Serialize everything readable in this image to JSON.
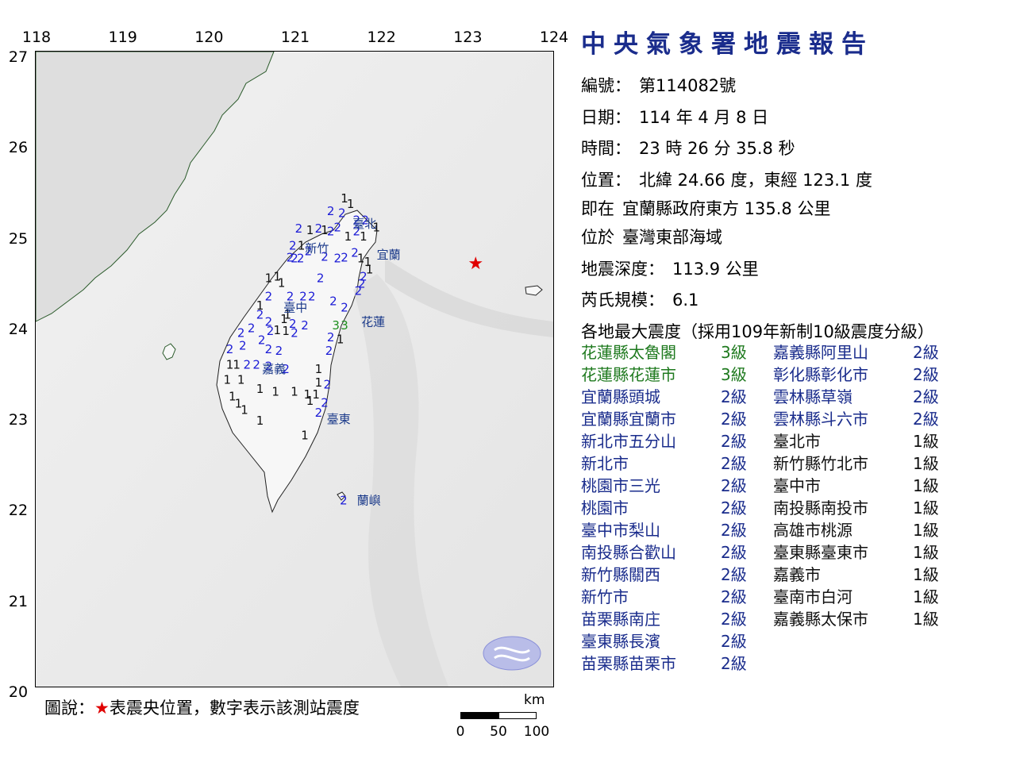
{
  "report": {
    "title": "中央氣象署地震報告",
    "number_label": "編號：",
    "number_value": "第114082號",
    "date_label": "日期：",
    "date_value": "114 年 4 月 8 日",
    "time_label": "時間：",
    "time_value": "23 時 26 分 35.8 秒",
    "position_label": "位置：",
    "position_value": "北緯 24.66 度，東經 123.1 度",
    "relative_label": "即在",
    "relative_value": "宜蘭縣政府東方 135.8 公里",
    "region_label": "位於",
    "region_value": "臺灣東部海域",
    "depth_label": "地震深度：",
    "depth_value": "113.9 公里",
    "magnitude_label": "芮氏規模：",
    "magnitude_value": "6.1",
    "intensity_heading": "各地最大震度（採用109年新制10級震度分級）"
  },
  "intensity_left": [
    {
      "location": "花蓮縣太魯閣",
      "level": "3級",
      "grade": 3
    },
    {
      "location": "花蓮縣花蓮市",
      "level": "3級",
      "grade": 3
    },
    {
      "location": "宜蘭縣頭城",
      "level": "2級",
      "grade": 2
    },
    {
      "location": "宜蘭縣宜蘭市",
      "level": "2級",
      "grade": 2
    },
    {
      "location": "新北市五分山",
      "level": "2級",
      "grade": 2
    },
    {
      "location": "新北市",
      "level": "2級",
      "grade": 2
    },
    {
      "location": "桃園市三光",
      "level": "2級",
      "grade": 2
    },
    {
      "location": "桃園市",
      "level": "2級",
      "grade": 2
    },
    {
      "location": "臺中市梨山",
      "level": "2級",
      "grade": 2
    },
    {
      "location": "南投縣合歡山",
      "level": "2級",
      "grade": 2
    },
    {
      "location": "新竹縣關西",
      "level": "2級",
      "grade": 2
    },
    {
      "location": "新竹市",
      "level": "2級",
      "grade": 2
    },
    {
      "location": "苗栗縣南庄",
      "level": "2級",
      "grade": 2
    },
    {
      "location": "臺東縣長濱",
      "level": "2級",
      "grade": 2
    },
    {
      "location": "苗栗縣苗栗市",
      "level": "2級",
      "grade": 2
    }
  ],
  "intensity_right": [
    {
      "location": "嘉義縣阿里山",
      "level": "2級",
      "grade": 2
    },
    {
      "location": "彰化縣彰化市",
      "level": "2級",
      "grade": 2
    },
    {
      "location": "雲林縣草嶺",
      "level": "2級",
      "grade": 2
    },
    {
      "location": "雲林縣斗六市",
      "level": "2級",
      "grade": 2
    },
    {
      "location": "臺北市",
      "level": "1級",
      "grade": 1
    },
    {
      "location": "新竹縣竹北市",
      "level": "1級",
      "grade": 1
    },
    {
      "location": "臺中市",
      "level": "1級",
      "grade": 1
    },
    {
      "location": "南投縣南投市",
      "level": "1級",
      "grade": 1
    },
    {
      "location": "高雄市桃源",
      "level": "1級",
      "grade": 1
    },
    {
      "location": "臺東縣臺東市",
      "level": "1級",
      "grade": 1
    },
    {
      "location": "嘉義市",
      "level": "1級",
      "grade": 1
    },
    {
      "location": "臺南市白河",
      "level": "1級",
      "grade": 1
    },
    {
      "location": "嘉義縣太保市",
      "level": "1級",
      "grade": 1
    }
  ],
  "map": {
    "lon_ticks": [
      "118",
      "119",
      "120",
      "121",
      "122",
      "123",
      "124"
    ],
    "lat_ticks": [
      "27",
      "26",
      "25",
      "24",
      "23",
      "22",
      "21",
      "20"
    ],
    "lon_range": [
      118,
      124
    ],
    "lat_range": [
      20,
      27
    ],
    "epicenter": {
      "lon": 123.1,
      "lat": 24.66
    },
    "place_names": [
      {
        "name": "臺北",
        "lon": 121.6,
        "lat": 25.1
      },
      {
        "name": "新竹",
        "lon": 121.05,
        "lat": 24.83
      },
      {
        "name": "宜蘭",
        "lon": 121.88,
        "lat": 24.76
      },
      {
        "name": "臺中",
        "lon": 120.8,
        "lat": 24.18
      },
      {
        "name": "花蓮",
        "lon": 121.7,
        "lat": 24.02
      },
      {
        "name": "嘉義",
        "lon": 120.55,
        "lat": 23.5
      },
      {
        "name": "臺東",
        "lon": 121.3,
        "lat": 22.95
      },
      {
        "name": "蘭嶼",
        "lon": 121.65,
        "lat": 22.05
      }
    ],
    "stations": [
      {
        "v": "1",
        "lon": 121.58,
        "lat": 25.38
      },
      {
        "v": "1",
        "lon": 121.65,
        "lat": 25.32
      },
      {
        "v": "2",
        "lon": 121.42,
        "lat": 25.24
      },
      {
        "v": "2",
        "lon": 121.55,
        "lat": 25.22
      },
      {
        "v": "2",
        "lon": 121.72,
        "lat": 25.14
      },
      {
        "v": "2",
        "lon": 121.82,
        "lat": 25.14
      },
      {
        "v": "1",
        "lon": 121.95,
        "lat": 25.06
      },
      {
        "v": "2",
        "lon": 121.05,
        "lat": 25.05
      },
      {
        "v": "1",
        "lon": 121.18,
        "lat": 25.03
      },
      {
        "v": "2",
        "lon": 121.28,
        "lat": 25.05
      },
      {
        "v": "1",
        "lon": 121.35,
        "lat": 25.03
      },
      {
        "v": "2",
        "lon": 121.42,
        "lat": 25.02
      },
      {
        "v": "2",
        "lon": 121.5,
        "lat": 25.06
      },
      {
        "v": "1",
        "lon": 121.62,
        "lat": 24.96
      },
      {
        "v": "1",
        "lon": 121.8,
        "lat": 24.96
      },
      {
        "v": "2",
        "lon": 121.72,
        "lat": 25.02
      },
      {
        "v": "2",
        "lon": 120.98,
        "lat": 24.86
      },
      {
        "v": "1",
        "lon": 121.08,
        "lat": 24.86
      },
      {
        "v": "2",
        "lon": 121.16,
        "lat": 24.8
      },
      {
        "v": "2",
        "lon": 120.95,
        "lat": 24.73
      },
      {
        "v": "2",
        "lon": 121.0,
        "lat": 24.72
      },
      {
        "v": "2",
        "lon": 121.07,
        "lat": 24.72
      },
      {
        "v": "2",
        "lon": 121.35,
        "lat": 24.74
      },
      {
        "v": "2",
        "lon": 121.5,
        "lat": 24.72
      },
      {
        "v": "2",
        "lon": 121.58,
        "lat": 24.73
      },
      {
        "v": "2",
        "lon": 121.7,
        "lat": 24.78
      },
      {
        "v": "1",
        "lon": 121.77,
        "lat": 24.72
      },
      {
        "v": "1",
        "lon": 121.85,
        "lat": 24.68
      },
      {
        "v": "1",
        "lon": 121.87,
        "lat": 24.6
      },
      {
        "v": "2",
        "lon": 121.8,
        "lat": 24.52
      },
      {
        "v": "2",
        "lon": 121.78,
        "lat": 24.44
      },
      {
        "v": "2",
        "lon": 121.74,
        "lat": 24.36
      },
      {
        "v": "1",
        "lon": 120.7,
        "lat": 24.5
      },
      {
        "v": "1",
        "lon": 120.8,
        "lat": 24.52
      },
      {
        "v": "1",
        "lon": 120.85,
        "lat": 24.45
      },
      {
        "v": "2",
        "lon": 121.3,
        "lat": 24.5
      },
      {
        "v": "2",
        "lon": 120.7,
        "lat": 24.3
      },
      {
        "v": "2",
        "lon": 120.95,
        "lat": 24.3
      },
      {
        "v": "2",
        "lon": 121.1,
        "lat": 24.3
      },
      {
        "v": "2",
        "lon": 121.2,
        "lat": 24.3
      },
      {
        "v": "1",
        "lon": 120.6,
        "lat": 24.2
      },
      {
        "v": "2",
        "lon": 121.45,
        "lat": 24.25
      },
      {
        "v": "2",
        "lon": 121.58,
        "lat": 24.18
      },
      {
        "v": "2",
        "lon": 120.6,
        "lat": 24.1
      },
      {
        "v": "2",
        "lon": 120.7,
        "lat": 24.02
      },
      {
        "v": "1",
        "lon": 120.88,
        "lat": 24.05
      },
      {
        "v": "1",
        "lon": 120.92,
        "lat": 24.1
      },
      {
        "v": "2",
        "lon": 120.98,
        "lat": 24.0
      },
      {
        "v": "2",
        "lon": 121.12,
        "lat": 23.98
      },
      {
        "v": "3",
        "lon": 121.48,
        "lat": 23.98
      },
      {
        "v": "3",
        "lon": 121.58,
        "lat": 23.98
      },
      {
        "v": "2",
        "lon": 120.38,
        "lat": 23.9
      },
      {
        "v": "2",
        "lon": 120.5,
        "lat": 23.95
      },
      {
        "v": "2",
        "lon": 120.72,
        "lat": 23.92
      },
      {
        "v": "1",
        "lon": 120.8,
        "lat": 23.93
      },
      {
        "v": "1",
        "lon": 120.9,
        "lat": 23.92
      },
      {
        "v": "2",
        "lon": 121.0,
        "lat": 23.9
      },
      {
        "v": "2",
        "lon": 120.62,
        "lat": 23.82
      },
      {
        "v": "2",
        "lon": 121.42,
        "lat": 23.85
      },
      {
        "v": "1",
        "lon": 121.53,
        "lat": 23.83
      },
      {
        "v": "2",
        "lon": 120.25,
        "lat": 23.72
      },
      {
        "v": "2",
        "lon": 120.4,
        "lat": 23.76
      },
      {
        "v": "2",
        "lon": 120.7,
        "lat": 23.72
      },
      {
        "v": "2",
        "lon": 120.82,
        "lat": 23.7
      },
      {
        "v": "2",
        "lon": 121.4,
        "lat": 23.7
      },
      {
        "v": "1",
        "lon": 120.25,
        "lat": 23.55
      },
      {
        "v": "1",
        "lon": 120.33,
        "lat": 23.55
      },
      {
        "v": "2",
        "lon": 120.45,
        "lat": 23.55
      },
      {
        "v": "2",
        "lon": 120.56,
        "lat": 23.55
      },
      {
        "v": "2",
        "lon": 120.7,
        "lat": 23.53
      },
      {
        "v": "2",
        "lon": 120.9,
        "lat": 23.5
      },
      {
        "v": "1",
        "lon": 121.28,
        "lat": 23.5
      },
      {
        "v": "1",
        "lon": 120.22,
        "lat": 23.38
      },
      {
        "v": "1",
        "lon": 120.38,
        "lat": 23.38
      },
      {
        "v": "1",
        "lon": 121.28,
        "lat": 23.35
      },
      {
        "v": "2",
        "lon": 121.38,
        "lat": 23.33
      },
      {
        "v": "1",
        "lon": 120.6,
        "lat": 23.28
      },
      {
        "v": "1",
        "lon": 120.78,
        "lat": 23.25
      },
      {
        "v": "1",
        "lon": 121.0,
        "lat": 23.25
      },
      {
        "v": "1",
        "lon": 121.15,
        "lat": 23.22
      },
      {
        "v": "1",
        "lon": 121.25,
        "lat": 23.22
      },
      {
        "v": "1",
        "lon": 120.28,
        "lat": 23.2
      },
      {
        "v": "1",
        "lon": 120.35,
        "lat": 23.12
      },
      {
        "v": "1",
        "lon": 121.18,
        "lat": 23.15
      },
      {
        "v": "2",
        "lon": 121.35,
        "lat": 23.13
      },
      {
        "v": "1",
        "lon": 120.42,
        "lat": 23.05
      },
      {
        "v": "2",
        "lon": 121.28,
        "lat": 23.02
      },
      {
        "v": "1",
        "lon": 120.6,
        "lat": 22.93
      },
      {
        "v": "1",
        "lon": 121.12,
        "lat": 22.77
      },
      {
        "v": "2",
        "lon": 121.57,
        "lat": 22.05
      }
    ]
  },
  "legend": {
    "prefix": "圖說：",
    "star": "★",
    "text": "表震央位置，數字表示該測站震度"
  },
  "scale": {
    "unit": "km",
    "labels": [
      "0",
      "50",
      "100"
    ]
  },
  "colors": {
    "title": "#1a2c8c",
    "level3": "#1f7a1f",
    "level2": "#1a2c8c",
    "level1": "#111111",
    "epicenter": "#e00000"
  }
}
